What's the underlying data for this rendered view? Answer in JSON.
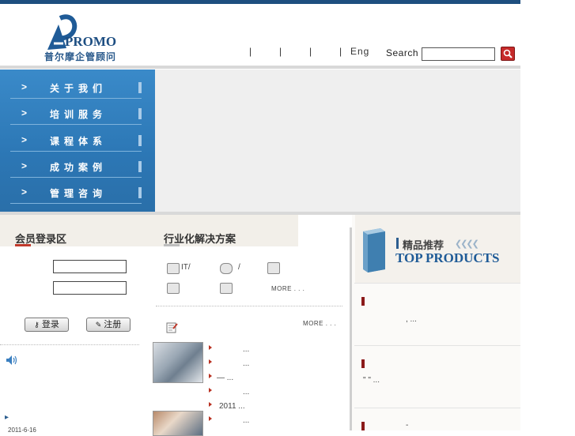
{
  "header": {
    "logo_text": "PROMO",
    "logo_zh": "普尔摩企管顾问",
    "nav": {
      "sep1": "|",
      "sep2": "|",
      "sep3": "|",
      "sep4": "|",
      "lang": "Eng"
    },
    "search_label": "Search",
    "search_value": ""
  },
  "menu": {
    "items": [
      {
        "label": "关于我们"
      },
      {
        "label": "培训服务"
      },
      {
        "label": "课程体系"
      },
      {
        "label": "成功案例"
      },
      {
        "label": "管理咨询"
      }
    ],
    "chevron": ">"
  },
  "login": {
    "title": "会员登录区",
    "login_button": "登录",
    "register_button": "注册",
    "date_text": "2011-6-16"
  },
  "industry": {
    "title": "行业化解决方案",
    "icon_row1": [
      {
        "text": "IT/"
      },
      {
        "text": "/"
      },
      {
        "text": ""
      }
    ],
    "icon_row2": [
      {
        "text": ""
      },
      {
        "text": ""
      }
    ],
    "more1": "MORE . . .",
    "more2": "MORE . . .",
    "news": [
      {
        "text": "..."
      },
      {
        "text": "..."
      },
      {
        "text": "—       ..."
      },
      {
        "text": "..."
      },
      {
        "text": "2011      ..."
      },
      {
        "text": "..."
      }
    ]
  },
  "products": {
    "title_zh": "精品推荐",
    "title_en": "TOP PRODUCTS",
    "items": [
      {
        "text": ",      ..."
      },
      {
        "text": "\"   \"          ..."
      },
      {
        "text": "-"
      }
    ]
  },
  "colors": {
    "accent": "#2c77b5",
    "brand_red": "#8b1a1a",
    "underline_red": "#c0392b"
  }
}
